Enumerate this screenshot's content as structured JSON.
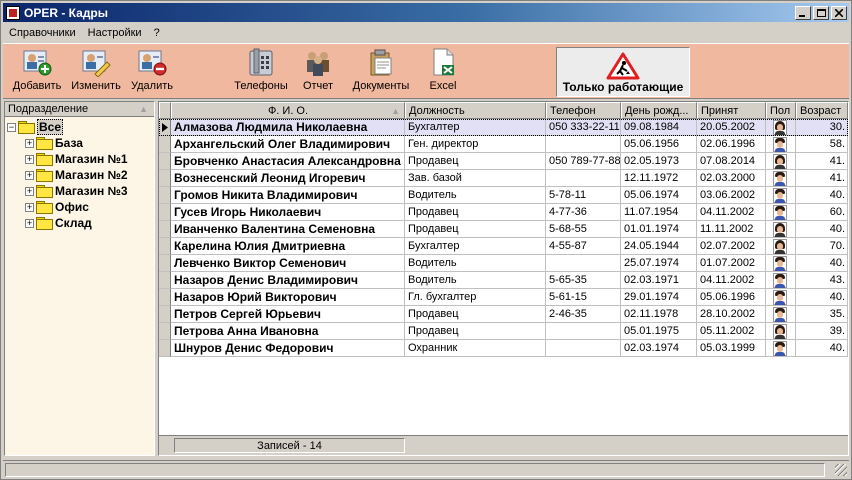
{
  "window": {
    "title": "OPER - Кадры"
  },
  "menu": [
    "Справочники",
    "Настройки",
    "?"
  ],
  "toolbar": {
    "add": "Добавить",
    "edit": "Изменить",
    "delete": "Удалить",
    "phones": "Телефоны",
    "report": "Отчет",
    "documents": "Документы",
    "excel": "Excel",
    "only_working": "Только работающие"
  },
  "tree": {
    "header": "Подразделение",
    "root": "Все",
    "children": [
      "База",
      "Магазин №1",
      "Магазин №2",
      "Магазин №3",
      "Офис",
      "Склад"
    ]
  },
  "grid": {
    "columns": [
      "Ф. И. О.",
      "Должность",
      "Телефон",
      "День рожд...",
      "Принят",
      "Пол",
      "Возраст"
    ],
    "rows": [
      {
        "name": "Алмазова Людмила Николаевна",
        "position": "Бухгалтер",
        "phone": "050 333-22-11",
        "birthday": "09.08.1984",
        "hired": "20.05.2002",
        "gender": "female",
        "age": "30."
      },
      {
        "name": "Архангельский Олег Владимирович",
        "position": "Ген. директор",
        "phone": "",
        "birthday": "05.06.1956",
        "hired": "02.06.1996",
        "gender": "male",
        "age": "58."
      },
      {
        "name": "Бровченко Анастасия Александровна",
        "position": "Продавец",
        "phone": "050 789-77-88",
        "birthday": "02.05.1973",
        "hired": "07.08.2014",
        "gender": "female",
        "age": "41."
      },
      {
        "name": "Вознесенский Леонид Игоревич",
        "position": "Зав. базой",
        "phone": "",
        "birthday": "12.11.1972",
        "hired": "02.03.2000",
        "gender": "male",
        "age": "41."
      },
      {
        "name": "Громов Никита Владимирович",
        "position": "Водитель",
        "phone": "5-78-11",
        "birthday": "05.06.1974",
        "hired": "03.06.2002",
        "gender": "male",
        "age": "40."
      },
      {
        "name": "Гусев Игорь Николаевич",
        "position": "Продавец",
        "phone": "4-77-36",
        "birthday": "11.07.1954",
        "hired": "04.11.2002",
        "gender": "male",
        "age": "60."
      },
      {
        "name": "Иванченко Валентина Семеновна",
        "position": "Продавец",
        "phone": "5-68-55",
        "birthday": "01.01.1974",
        "hired": "11.11.2002",
        "gender": "female",
        "age": "40."
      },
      {
        "name": "Карелина Юлия Дмитриевна",
        "position": "Бухгалтер",
        "phone": "4-55-87",
        "birthday": "24.05.1944",
        "hired": "02.07.2002",
        "gender": "female",
        "age": "70."
      },
      {
        "name": "Левченко Виктор Семенович",
        "position": "Водитель",
        "phone": "",
        "birthday": "25.07.1974",
        "hired": "01.07.2002",
        "gender": "male",
        "age": "40."
      },
      {
        "name": "Назаров Денис Владимирович",
        "position": "Водитель",
        "phone": "5-65-35",
        "birthday": "02.03.1971",
        "hired": "04.11.2002",
        "gender": "male",
        "age": "43."
      },
      {
        "name": "Назаров Юрий Викторович",
        "position": "Гл. бухгалтер",
        "phone": "5-61-15",
        "birthday": "29.01.1974",
        "hired": "05.06.1996",
        "gender": "male",
        "age": "40."
      },
      {
        "name": "Петров Сергей Юрьевич",
        "position": "Продавец",
        "phone": "2-46-35",
        "birthday": "02.11.1978",
        "hired": "28.10.2002",
        "gender": "male",
        "age": "35."
      },
      {
        "name": "Петрова Анна Ивановна",
        "position": "Продавец",
        "phone": "",
        "birthday": "05.01.1975",
        "hired": "05.11.2002",
        "gender": "female",
        "age": "39."
      },
      {
        "name": "Шнуров Денис Федорович",
        "position": "Охранник",
        "phone": "",
        "birthday": "02.03.1974",
        "hired": "05.03.1999",
        "gender": "male",
        "age": "40."
      }
    ],
    "records_label": "Записей - 14"
  },
  "colors": {
    "toolbar_bg": "#f0b89e",
    "tree_bg": "#fdf5e6",
    "selected_row": "#e2e0f4",
    "title_start": "#0a246a"
  }
}
